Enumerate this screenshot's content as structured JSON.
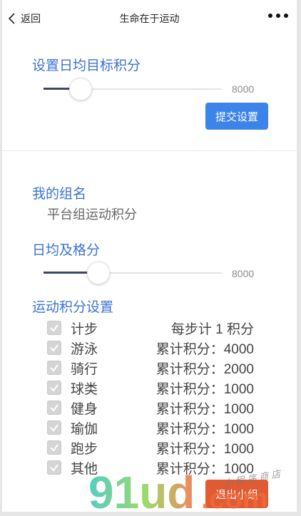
{
  "nav": {
    "back_label": "返回",
    "title": "生命在于运动"
  },
  "target": {
    "title": "设置日均目标积分",
    "slider_value": "8000",
    "slider_fraction": 0.2,
    "submit_label": "提交设置"
  },
  "group": {
    "title": "我的组名",
    "name": "平台组运动积分"
  },
  "pass": {
    "title": "日均及格分",
    "slider_value": "8000",
    "slider_fraction": 0.3
  },
  "scores": {
    "title": "运动积分设置",
    "items": [
      {
        "name": "计步",
        "rule": "每步计 1 积分",
        "checked": true
      },
      {
        "name": "游泳",
        "rule": "累计积分：4000",
        "checked": true
      },
      {
        "name": "骑行",
        "rule": "累计积分：2000",
        "checked": true
      },
      {
        "name": "球类",
        "rule": "累计积分：1000",
        "checked": true
      },
      {
        "name": "健身",
        "rule": "累计积分：1000",
        "checked": true
      },
      {
        "name": "瑜伽",
        "rule": "累计积分：1000",
        "checked": true
      },
      {
        "name": "跑步",
        "rule": "累计积分：1000",
        "checked": true
      },
      {
        "name": "其他",
        "rule": "累计积分：1000",
        "checked": true
      }
    ]
  },
  "exit_label": "退出小组",
  "watermark": {
    "brand": "91ud",
    "suffix": ".com",
    "store": "小程序商店"
  },
  "colors": {
    "accent": "#3b73d1",
    "primary_button": "#3c83ea",
    "danger_button": "#e05a33"
  }
}
